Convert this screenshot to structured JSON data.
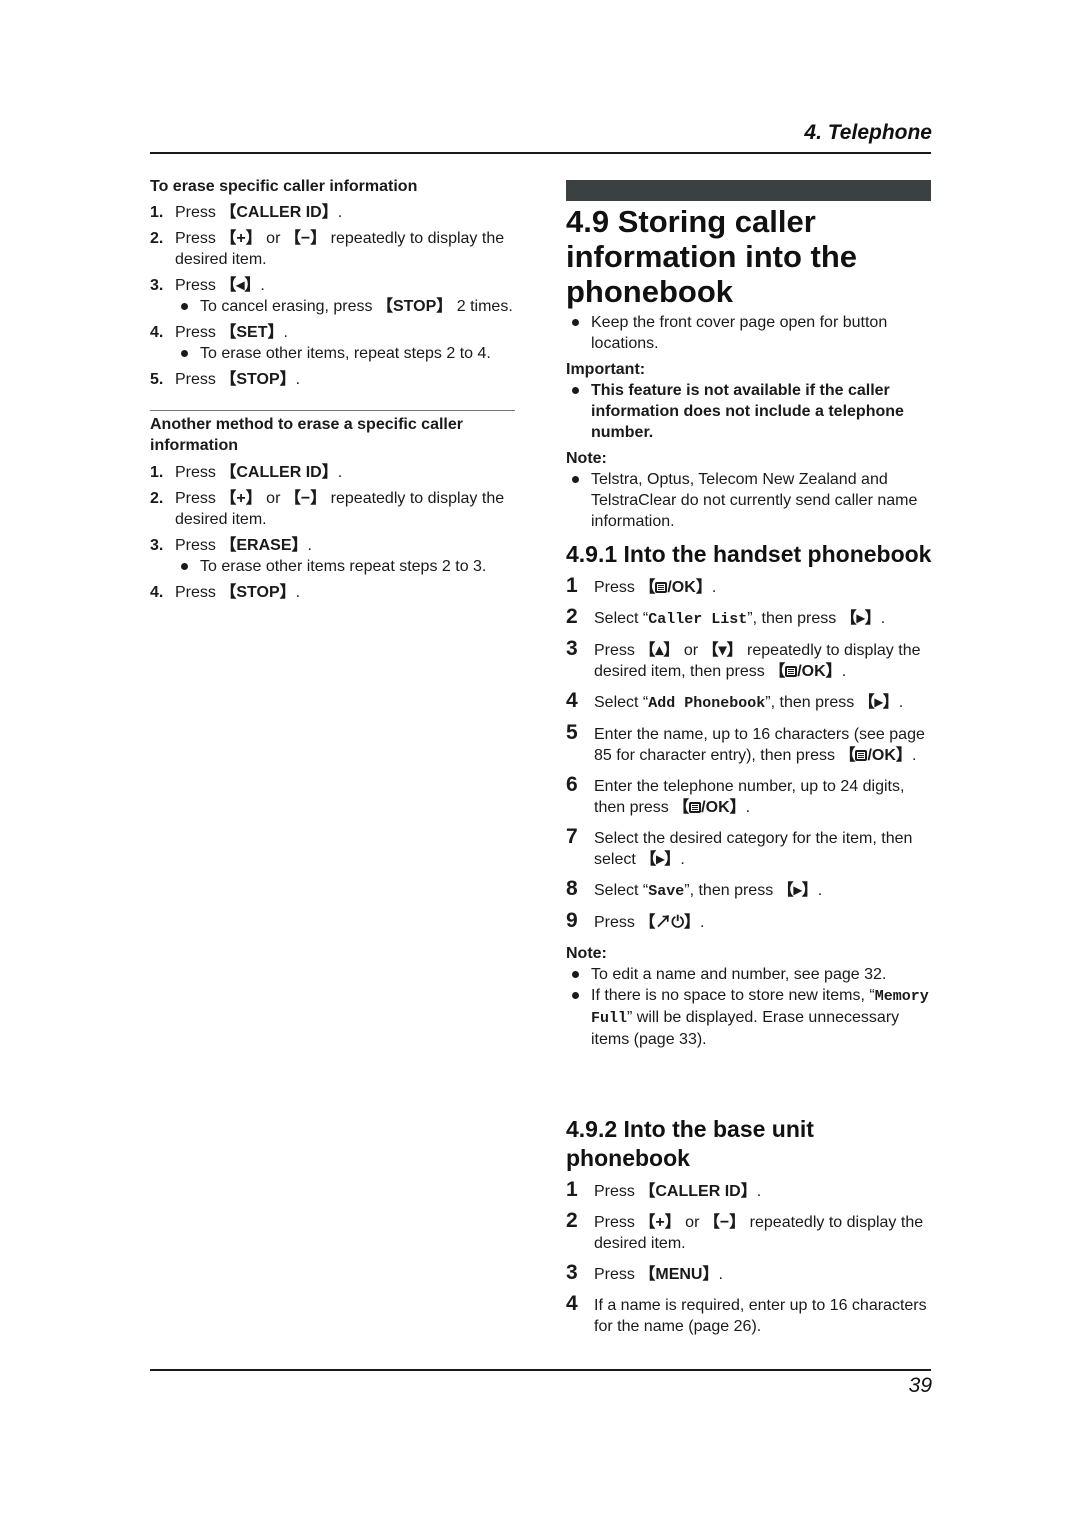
{
  "header": {
    "chapter": "4. Telephone"
  },
  "left": {
    "section1": {
      "title": "To erase specific caller information",
      "steps": [
        {
          "n": "1.",
          "pre": "Press ",
          "key": "CALLER ID",
          "post": "."
        },
        {
          "n": "2.",
          "pre": "Press ",
          "key": "+",
          "mid": " or ",
          "key2": "−",
          "post": " repeatedly to display the desired item."
        },
        {
          "n": "3.",
          "pre": "Press ",
          "key": "◂",
          "post": ".",
          "sub": {
            "pre": "To cancel erasing, press ",
            "key": "STOP",
            "post": " 2 times."
          }
        },
        {
          "n": "4.",
          "pre": "Press ",
          "key": "SET",
          "post": ".",
          "sub": {
            "text": "To erase other items, repeat steps 2 to 4."
          }
        },
        {
          "n": "5.",
          "pre": "Press ",
          "key": "STOP",
          "post": "."
        }
      ]
    },
    "section2": {
      "title": "Another method to erase a specific caller information",
      "steps": [
        {
          "n": "1.",
          "pre": "Press ",
          "key": "CALLER ID",
          "post": "."
        },
        {
          "n": "2.",
          "pre": "Press ",
          "key": "+",
          "mid": " or ",
          "key2": "−",
          "post": " repeatedly to display the desired item."
        },
        {
          "n": "3.",
          "pre": "Press ",
          "key": "ERASE",
          "post": ".",
          "sub": {
            "text": "To erase other items repeat steps 2 to 3."
          }
        },
        {
          "n": "4.",
          "pre": "Press ",
          "key": "STOP",
          "post": "."
        }
      ]
    }
  },
  "right": {
    "title": "4.9 Storing caller information into the phonebook",
    "intro": "Keep the front cover page open for button locations.",
    "important_label": "Important:",
    "important_text": "This feature is not available if the caller information does not include a telephone number.",
    "note_label": "Note:",
    "note_text": "Telstra, Optus, Telecom New Zealand and TelstraClear do not currently send caller name information.",
    "handset": {
      "title": "4.9.1 Into the handset phonebook",
      "steps": {
        "s1": {
          "n": "1",
          "pre": "Press ",
          "key": "/OK",
          "post": "."
        },
        "s2": {
          "n": "2",
          "pre": "Select “",
          "mono": "Caller List",
          "mid": "”, then press ",
          "key": "▸",
          "post": "."
        },
        "s3": {
          "n": "3",
          "pre": "Press ",
          "key": "▴",
          "mid": " or ",
          "key2": "▾",
          "mid2": " repeatedly to display the desired item, then press ",
          "key3": "/OK",
          "post": "."
        },
        "s4": {
          "n": "4",
          "pre": "Select “",
          "mono": "Add Phonebook",
          "mid": "”, then press ",
          "key": "▸",
          "post": "."
        },
        "s5": {
          "n": "5",
          "pre": "Enter the name, up to 16 characters (see page 85 for character entry), then press ",
          "key": "/OK",
          "post": "."
        },
        "s6": {
          "n": "6",
          "pre": "Enter the telephone number, up to 24 digits, then press ",
          "key": "/OK",
          "post": "."
        },
        "s7": {
          "n": "7",
          "pre": "Select the desired category for the item, then select ",
          "key": "▸",
          "post": "."
        },
        "s8": {
          "n": "8",
          "pre": "Select “",
          "mono": "Save",
          "mid": "”, then press ",
          "key": "▸",
          "post": "."
        },
        "s9": {
          "n": "9",
          "pre": "Press ",
          "key": "↗⏻",
          "post": "."
        }
      },
      "note_label": "Note:",
      "notes": {
        "n1": "To edit a name and number, see page 32.",
        "n2_pre": "If there is no space to store new items, “",
        "n2_mono": "Memory Full",
        "n2_post": "” will be displayed. Erase unnecessary items (page 33)."
      }
    },
    "base": {
      "title": "4.9.2 Into the base unit phonebook",
      "steps": {
        "s1": {
          "n": "1",
          "pre": "Press ",
          "key": "CALLER ID",
          "post": "."
        },
        "s2": {
          "n": "2",
          "pre": "Press ",
          "key": "+",
          "mid": " or ",
          "key2": "−",
          "post": " repeatedly to display the desired item."
        },
        "s3": {
          "n": "3",
          "pre": "Press ",
          "key": "MENU",
          "post": "."
        },
        "s4": {
          "n": "4",
          "text": "If a name is required, enter up to 16 characters for the name (page 26)."
        }
      }
    }
  },
  "footer": {
    "page_number": "39"
  }
}
